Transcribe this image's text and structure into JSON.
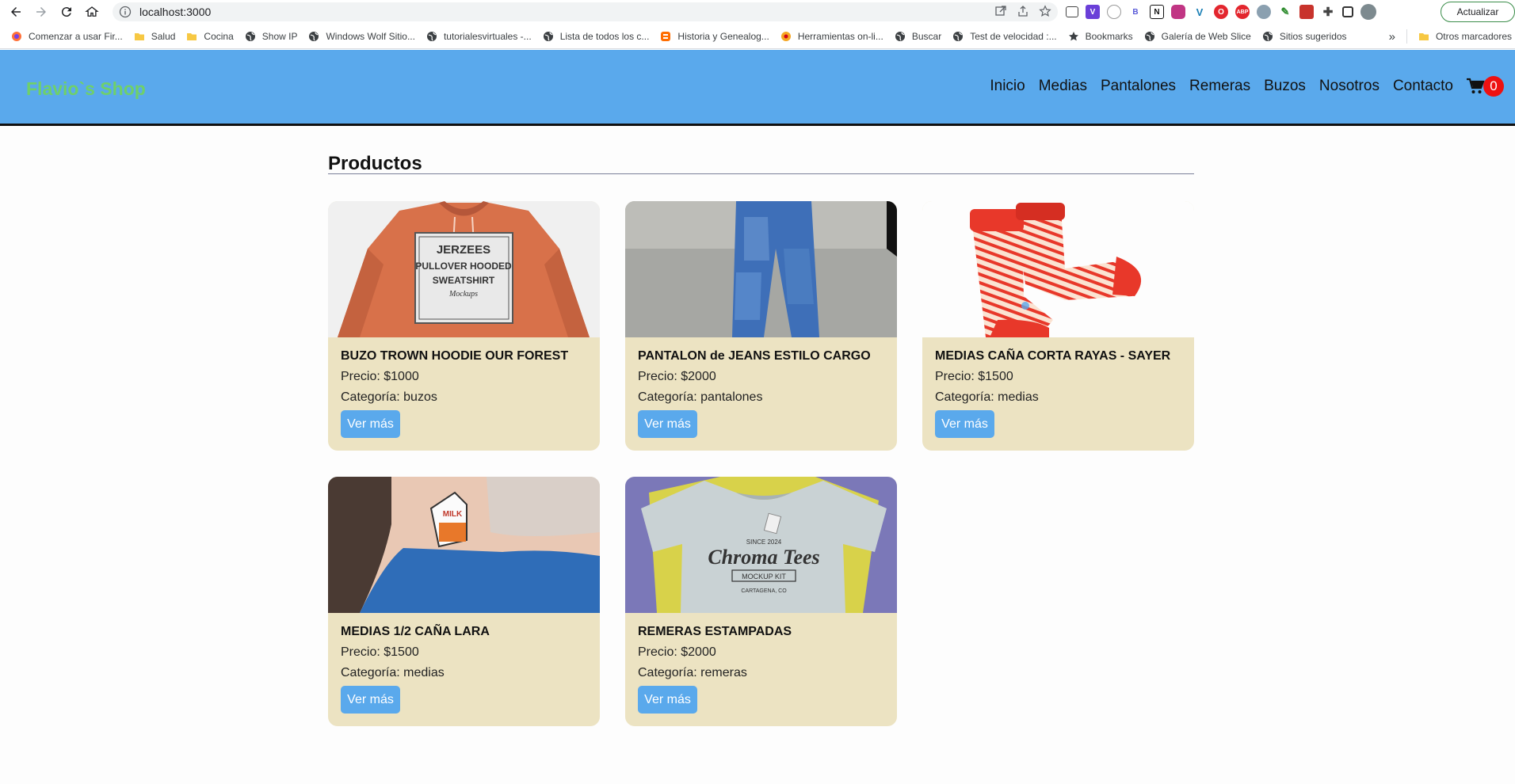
{
  "browser": {
    "url": "localhost:3000",
    "update_label": "Actualizar",
    "bookmarks": [
      {
        "label": "Comenzar a usar Fir...",
        "icon": "firefox-icon"
      },
      {
        "label": "Salud",
        "icon": "folder-icon"
      },
      {
        "label": "Cocina",
        "icon": "folder-icon"
      },
      {
        "label": "Show IP",
        "icon": "globe-icon"
      },
      {
        "label": "Windows Wolf Sitio...",
        "icon": "globe-icon"
      },
      {
        "label": "tutorialesvirtuales -...",
        "icon": "globe-icon"
      },
      {
        "label": "Lista de todos los c...",
        "icon": "globe-icon"
      },
      {
        "label": "Historia y Genealog...",
        "icon": "blogger-icon"
      },
      {
        "label": "Herramientas on-li...",
        "icon": "tools-icon"
      },
      {
        "label": "Buscar",
        "icon": "globe-icon"
      },
      {
        "label": "Test de velocidad :...",
        "icon": "globe-icon"
      },
      {
        "label": "Bookmarks",
        "icon": "star-icon"
      },
      {
        "label": "Galería de Web Slice",
        "icon": "globe-icon"
      },
      {
        "label": "Sitios sugeridos",
        "icon": "globe-icon"
      }
    ],
    "more_label": "»",
    "other_bookmarks": "Otros marcadores"
  },
  "site": {
    "brand": "Flavio`s Shop",
    "nav": [
      "Inicio",
      "Medias",
      "Pantalones",
      "Remeras",
      "Buzos",
      "Nosotros",
      "Contacto"
    ],
    "cart_count": "0"
  },
  "main": {
    "title": "Productos",
    "products": [
      {
        "name": "BUZO TROWN HOODIE OUR FOREST",
        "price": "Precio: $1000",
        "category": "Categoría: buzos",
        "button": "Ver más",
        "image": "orange-hoodie"
      },
      {
        "name": "PANTALON de JEANS ESTILO CARGO",
        "price": "Precio: $2000",
        "category": "Categoría: pantalones",
        "button": "Ver más",
        "image": "cargo-jeans"
      },
      {
        "name": "MEDIAS CAÑA CORTA RAYAS - SAYER",
        "price": "Precio: $1500",
        "category": "Categoría: medias",
        "button": "Ver más",
        "image": "striped-socks"
      },
      {
        "name": "MEDIAS 1/2 CAÑA LARA",
        "price": "Precio: $1500",
        "category": "Categoría: medias",
        "button": "Ver más",
        "image": "milk-sock"
      },
      {
        "name": "REMERAS ESTAMPADAS",
        "price": "Precio: $2000",
        "category": "Categoría: remeras",
        "button": "Ver más",
        "image": "printed-tshirt"
      }
    ]
  },
  "images": {
    "hoodie_print": [
      "JERZEES",
      "PULLOVER HOODED",
      "SWEATSHIRT",
      "Mockups"
    ],
    "sock_print": "MILK",
    "tshirt_print": [
      "SINCE 2024",
      "Chroma Tees",
      "MOCKUP KIT",
      "CARTAGENA, CO"
    ]
  },
  "colors": {
    "header": "#5aa9ec",
    "brand": "#6fd06a",
    "card": "#ece3c2",
    "button": "#5aa9ec",
    "badge": "#ee1111"
  }
}
